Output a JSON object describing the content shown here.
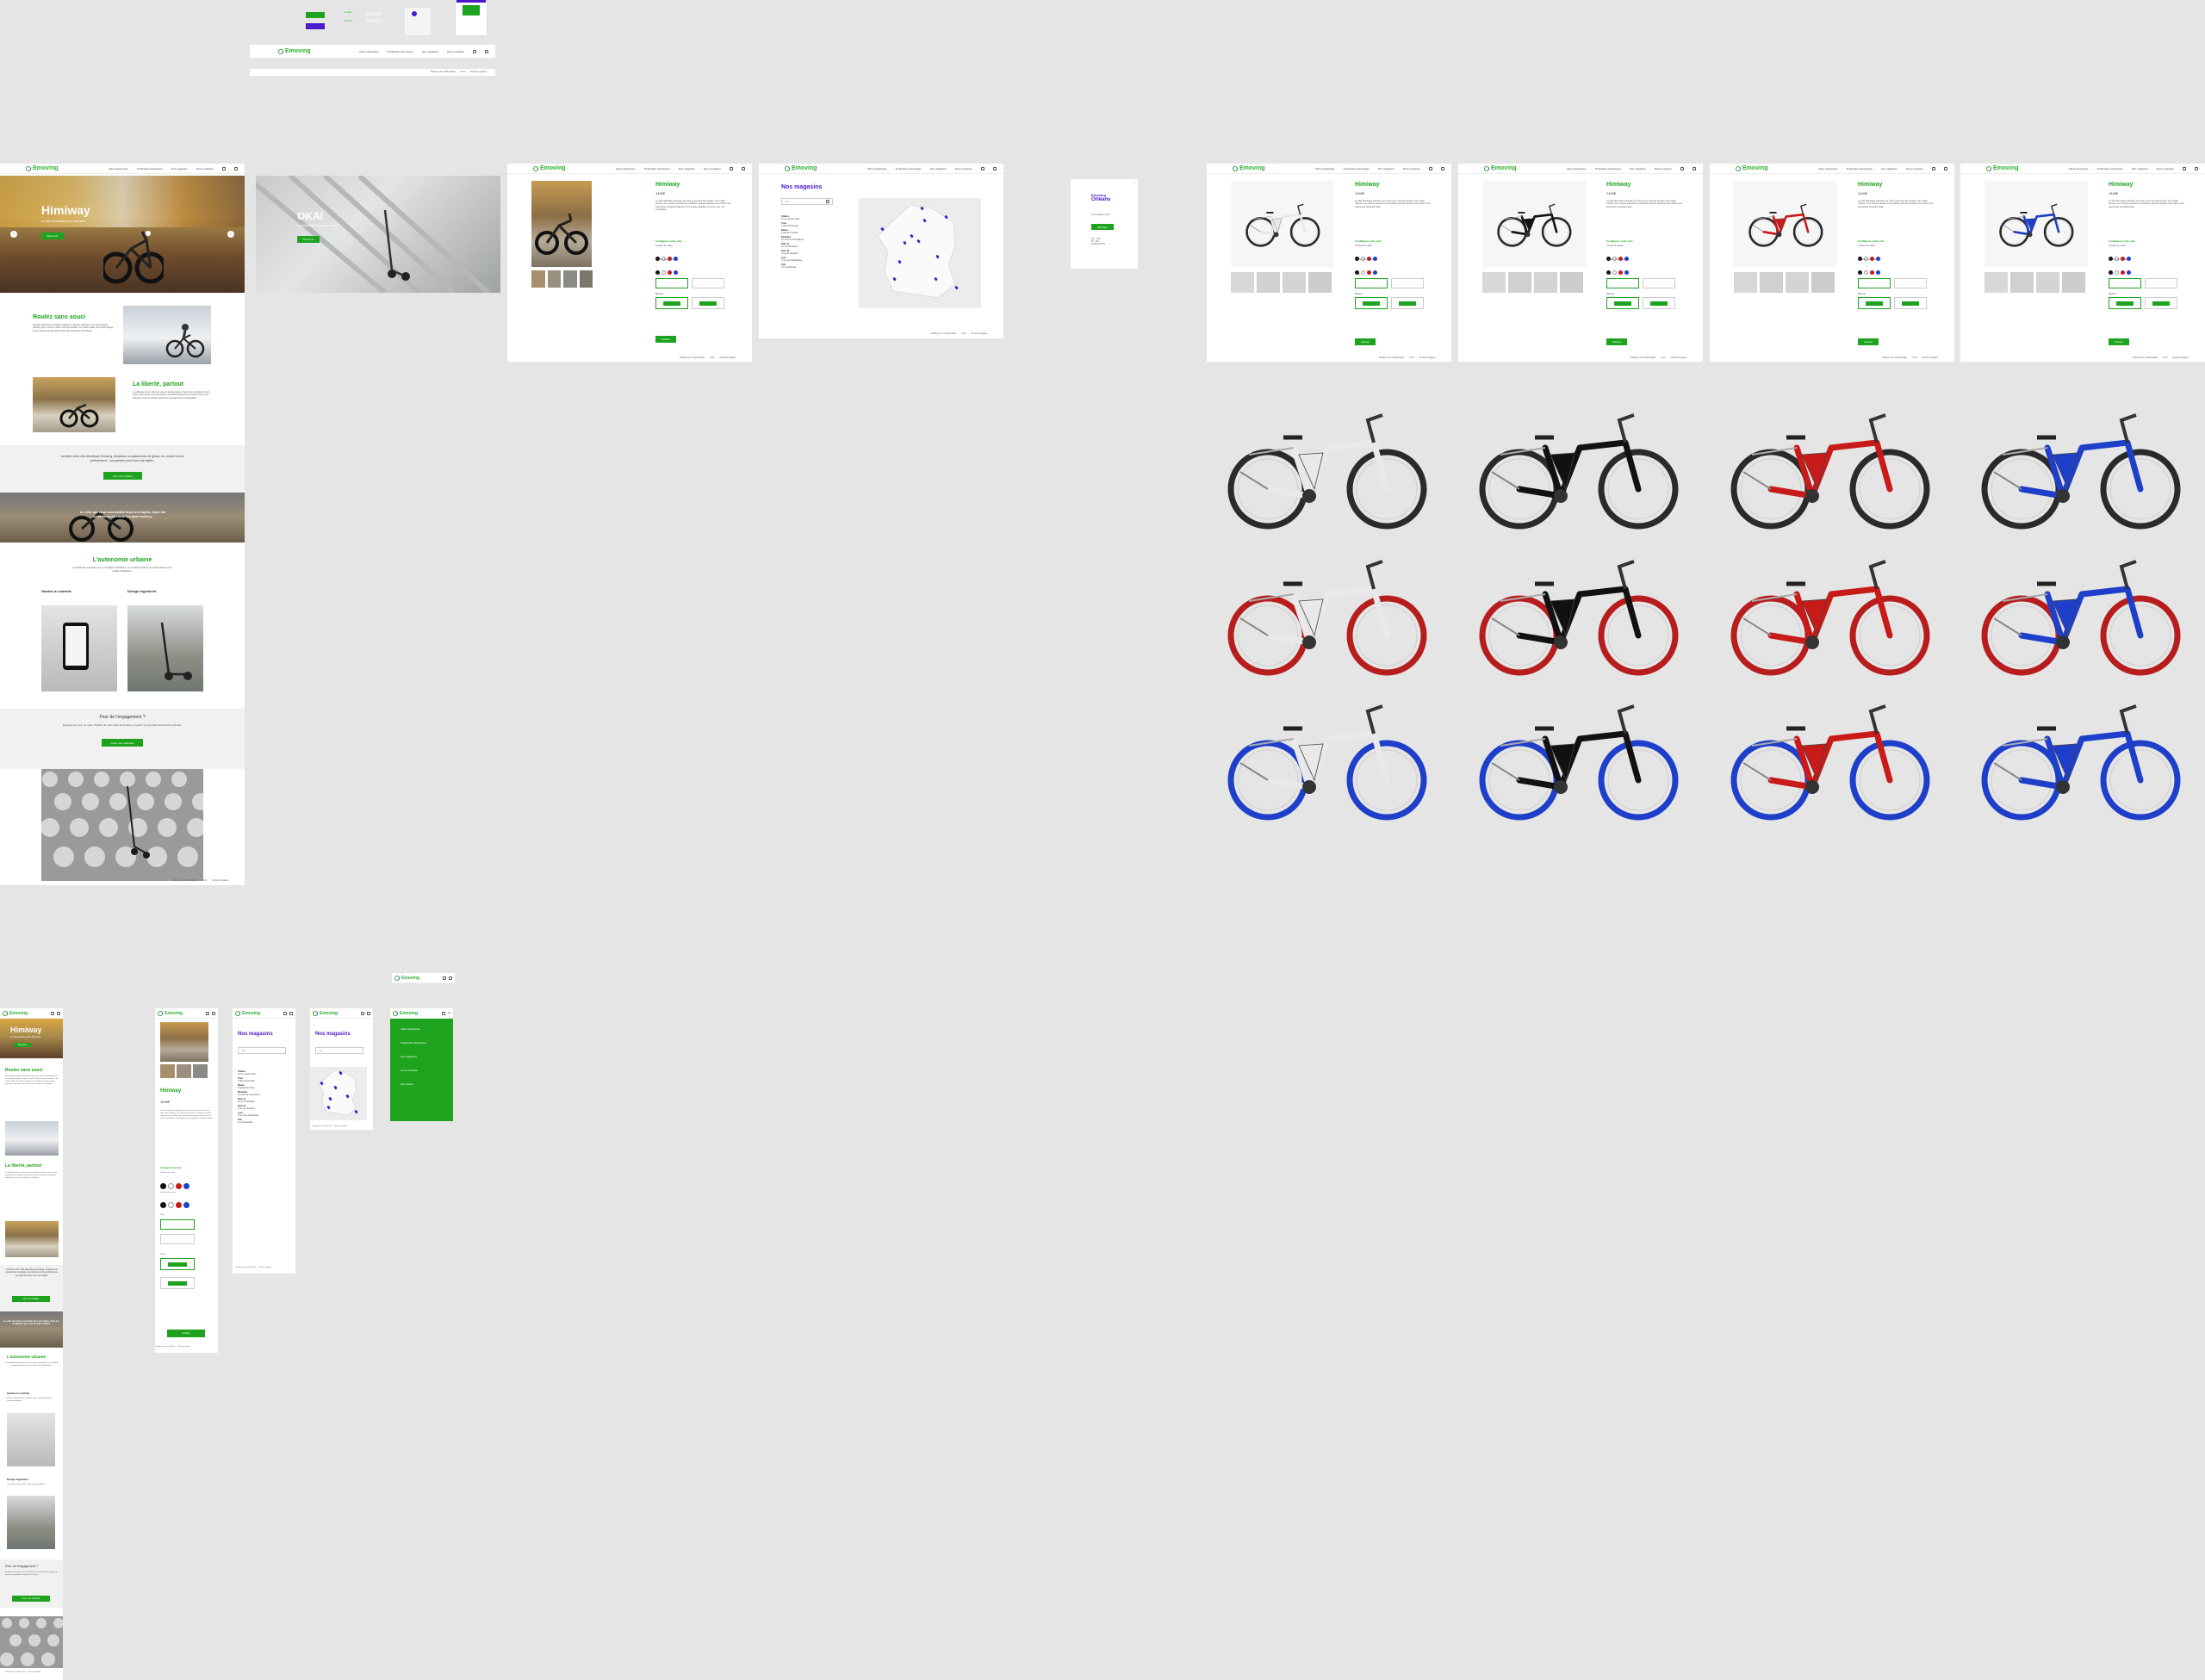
{
  "brand": {
    "name": "Emoving",
    "green": "#1ea31e",
    "purple": "#4a19c9",
    "bg": "#e5e5e5"
  },
  "nav": {
    "links": [
      "Vélos électriques",
      "Trottinettes électriques",
      "Nos magasins",
      "Nous contacter"
    ]
  },
  "home": {
    "hero_title": "Himiway",
    "hero_sub": "Le vélo électrique pour l'aventure",
    "hero_btn": "Découvrir",
    "slide2_title": "OKAI",
    "slide2_sub": "La trottinette électrique urbaine",
    "s1_title": "Roulez sans souci",
    "s2_title": "La liberté, partout",
    "cta_text": "Achetez votre vélo électrique Emoving. Amateurs ou passionnés de glisse, au confort et à la performance, une gamme pour tous vos trajets.",
    "cta_btn": "Voir nos modèles",
    "banner_text": "Le vélo qui rend accessible tous les trajets, dans les conditions de route les plus variées.",
    "urban_title": "L'autonomie urbaine",
    "urban_text": "La trottinette électrique pour vos trajets quotidiens, un excellent rapport de performance et de facilité d'utilisation.",
    "col1_title": "Gardez le contrôle",
    "col2_title": "Design ingénieris",
    "engage_title": "Peur de l'engagement ?",
    "engage_text": "Essayez-les pour un mois. Profitez de notre offre de location et testez nos produits avant de les acheter.",
    "engage_btn": "Louer une trottinette"
  },
  "product": {
    "title": "Himiway",
    "price": "1499€",
    "config_label": "Configurez votre vélo",
    "color_frame": "Couleur du cadre",
    "color_wheels": "Couleur des roues",
    "size_label": "Taille",
    "battery_label": "Batterie",
    "buy_btn": "Acheter"
  },
  "stores": {
    "title": "Nos magasins",
    "search_placeholder": "Ville...",
    "list": [
      {
        "city": "Orléans",
        "addr": "12 rue Jeanne d'Arc"
      },
      {
        "city": "Tours",
        "addr": "5 place Plumereau"
      },
      {
        "city": "Nantes",
        "addr": "8 quai de la Fosse"
      },
      {
        "city": "Bordeaux",
        "addr": "21 cours de l'Intendance"
      },
      {
        "city": "Paris 11",
        "addr": "44 rue Oberkampf"
      },
      {
        "city": "Paris 15",
        "addr": "9 rue de Vaugirard"
      },
      {
        "city": "Lyon",
        "addr": "3 rue de la République"
      },
      {
        "city": "Lille",
        "addr": "14 rue Nationale"
      }
    ],
    "popup_brand": "Emoving",
    "popup_city": "Orléans",
    "popup_btn": "Itinéraire"
  },
  "footer": {
    "links": [
      "Politique de confidentialité",
      "CGV",
      "Mentions légales"
    ]
  },
  "mobile_menu": [
    "Vélos électriques",
    "Trottinettes électriques",
    "Nos magasins",
    "Nous contacter",
    "Mon panier"
  ],
  "variants": {
    "frames": [
      "#e9e9e9",
      "#111111",
      "#c91a1a",
      "#1d3fc9"
    ],
    "wheels": [
      "#2a2a2a",
      "#b81d1d",
      "#1d3fc9"
    ]
  }
}
